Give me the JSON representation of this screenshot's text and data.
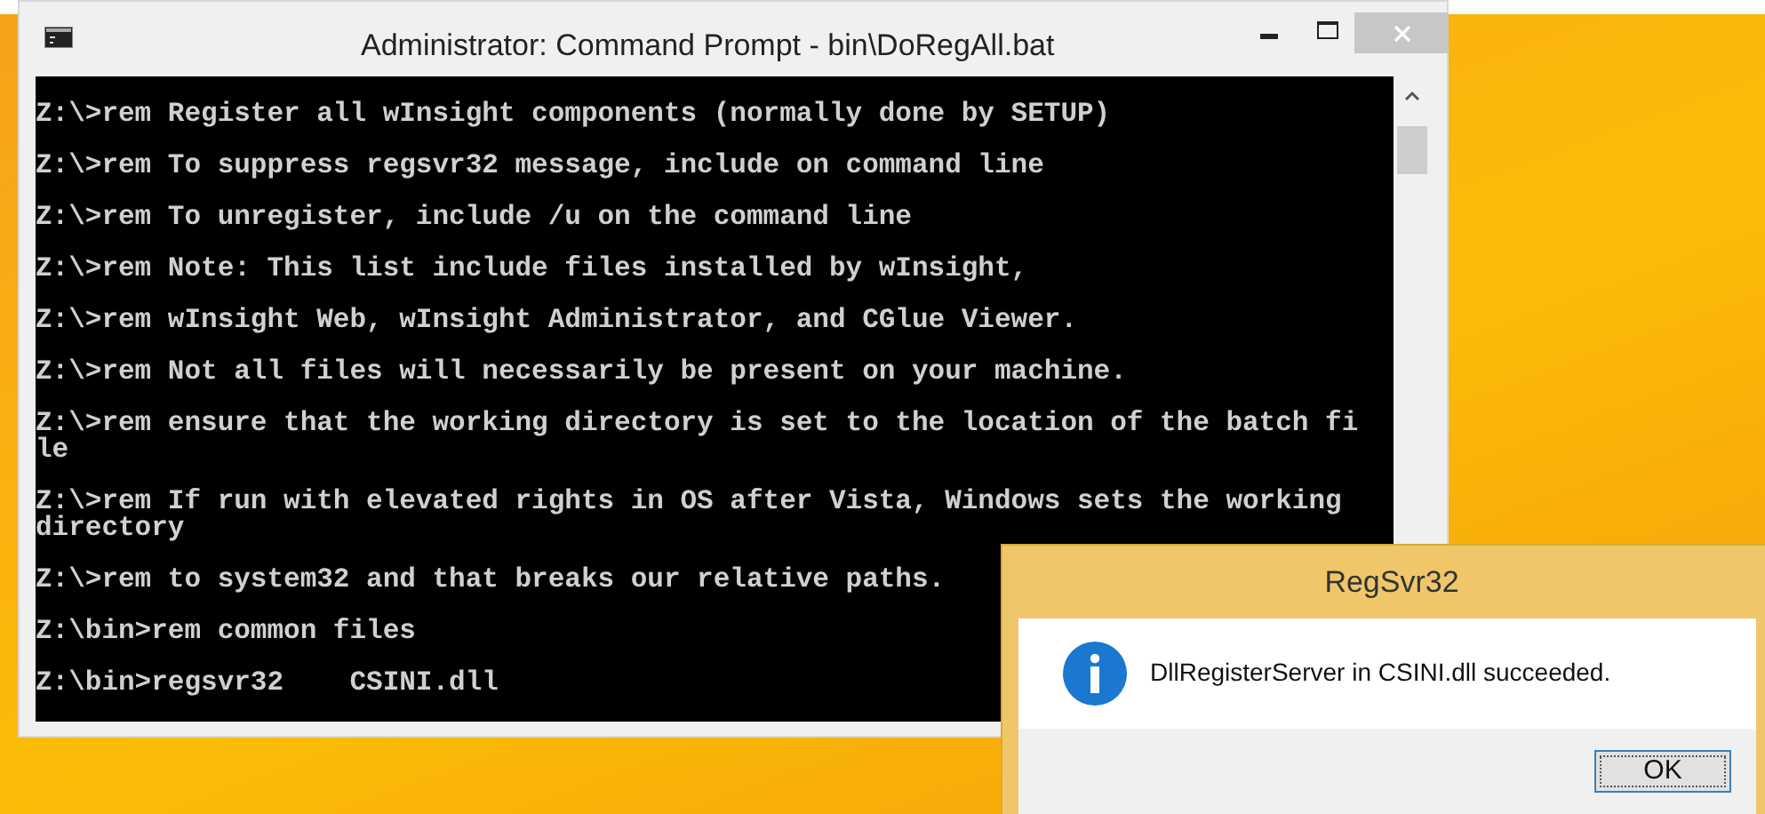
{
  "console_window": {
    "title": "Administrator: Command Prompt - bin\\DoRegAll.bat",
    "lines": [
      {
        "rows": [
          "Z:\\>rem Register all wInsight components (normally done by SETUP)"
        ]
      },
      {
        "rows": [
          "Z:\\>rem To suppress regsvr32 message, include on command line"
        ]
      },
      {
        "rows": [
          "Z:\\>rem To unregister, include /u on the command line"
        ]
      },
      {
        "rows": [
          "Z:\\>rem Note: This list include files installed by wInsight,"
        ]
      },
      {
        "rows": [
          "Z:\\>rem wInsight Web, wInsight Administrator, and CGlue Viewer."
        ]
      },
      {
        "rows": [
          "Z:\\>rem Not all files will necessarily be present on your machine."
        ]
      },
      {
        "rows": [
          "Z:\\>rem ensure that the working directory is set to the location of the batch fi",
          "le"
        ]
      },
      {
        "rows": [
          "Z:\\>rem If run with elevated rights in OS after Vista, Windows sets the working",
          "directory"
        ]
      },
      {
        "rows": [
          "Z:\\>rem to system32 and that breaks our relative paths."
        ]
      },
      {
        "rows": [
          "Z:\\bin>rem common files"
        ]
      },
      {
        "rows": [
          "Z:\\bin>regsvr32    CSINI.dll"
        ]
      }
    ]
  },
  "dialog": {
    "title": "RegSvr32",
    "message": "DllRegisterServer in CSINI.dll succeeded.",
    "button": "OK"
  }
}
